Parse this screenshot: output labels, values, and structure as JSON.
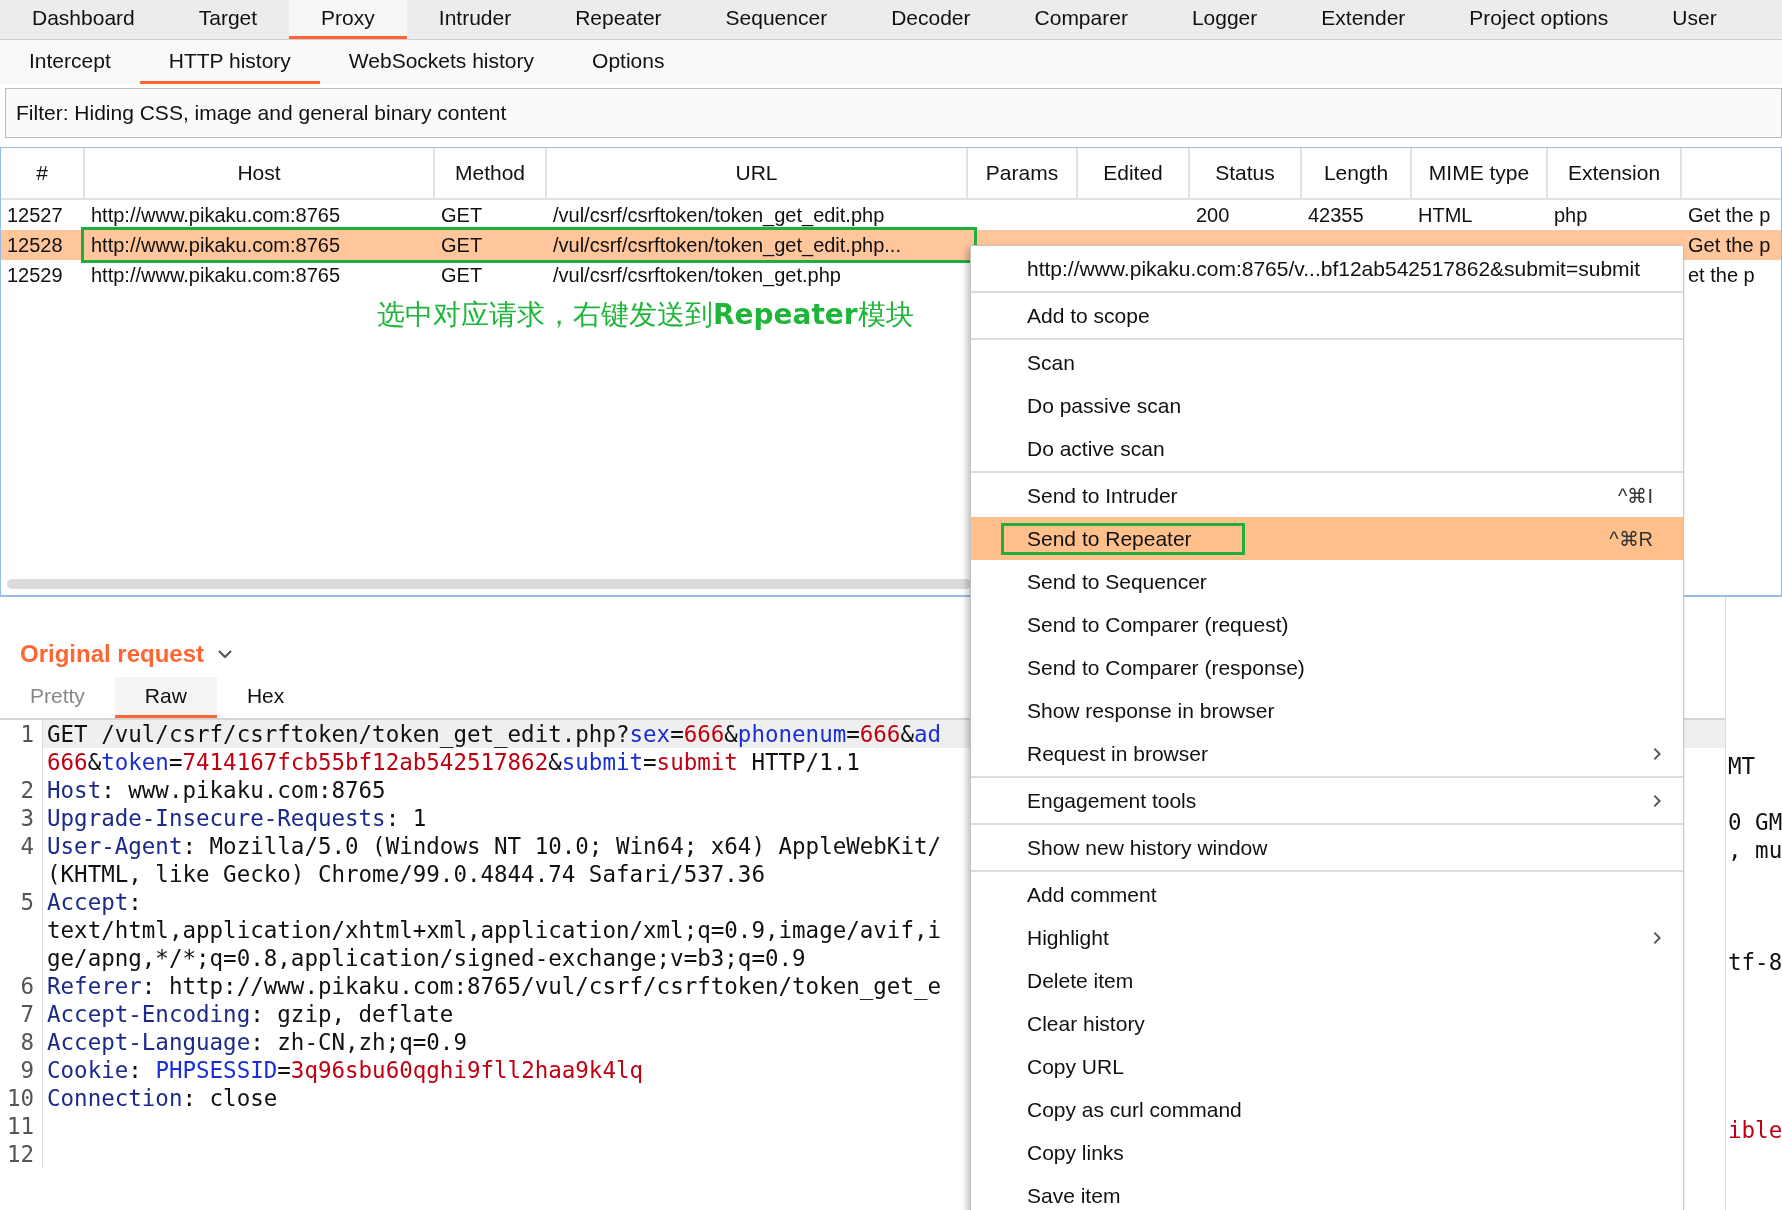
{
  "main_tabs": [
    {
      "label": "Dashboard",
      "selected": false
    },
    {
      "label": "Target",
      "selected": false
    },
    {
      "label": "Proxy",
      "selected": true
    },
    {
      "label": "Intruder",
      "selected": false
    },
    {
      "label": "Repeater",
      "selected": false
    },
    {
      "label": "Sequencer",
      "selected": false
    },
    {
      "label": "Decoder",
      "selected": false
    },
    {
      "label": "Comparer",
      "selected": false
    },
    {
      "label": "Logger",
      "selected": false
    },
    {
      "label": "Extender",
      "selected": false
    },
    {
      "label": "Project options",
      "selected": false
    },
    {
      "label": "User",
      "selected": false
    }
  ],
  "sub_tabs": [
    {
      "label": "Intercept",
      "selected": false
    },
    {
      "label": "HTTP history",
      "selected": true
    },
    {
      "label": "WebSockets history",
      "selected": false
    },
    {
      "label": "Options",
      "selected": false
    }
  ],
  "filter": {
    "text": "Filter: Hiding CSS, image and general binary content"
  },
  "table": {
    "columns": [
      "#",
      "Host",
      "Method",
      "URL",
      "Params",
      "Edited",
      "Status",
      "Length",
      "MIME type",
      "Extension"
    ],
    "rows": [
      {
        "selected": false,
        "annotated": false,
        "cells": [
          "12527",
          "http://www.pikaku.com:8765",
          "GET",
          "/vul/csrf/csrftoken/token_get_edit.php",
          null,
          null,
          "200",
          "42355",
          "HTML",
          "php",
          "Get the p"
        ]
      },
      {
        "selected": true,
        "annotated": true,
        "cells": [
          "12528",
          "http://www.pikaku.com:8765",
          "GET",
          "/vul/csrf/csrftoken/token_get_edit.php...",
          null,
          null,
          null,
          null,
          null,
          null,
          "Get the p"
        ]
      },
      {
        "selected": false,
        "annotated": false,
        "cells": [
          "12529",
          "http://www.pikaku.com:8765",
          "GET",
          "/vul/csrf/csrftoken/token_get.php",
          null,
          null,
          null,
          null,
          null,
          null,
          "et the p"
        ]
      }
    ]
  },
  "annotation": "选中对应请求，右键发送到**Repeater**模块",
  "request_panel": {
    "title": "Original request",
    "tabs": [
      {
        "label": "Pretty",
        "selected": false
      },
      {
        "label": "Raw",
        "selected": true
      },
      {
        "label": "Hex",
        "selected": false
      }
    ],
    "rows": [
      {
        "number": "1",
        "highlighted": true,
        "segments": [
          {
            "kind": "plain",
            "text": "GET /vul/csrf/csrftoken/token_get_edit.php?"
          },
          {
            "kind": "param",
            "text": "sex"
          },
          {
            "kind": "plain",
            "text": "="
          },
          {
            "kind": "value",
            "text": "666"
          },
          {
            "kind": "plain",
            "text": "&"
          },
          {
            "kind": "param",
            "text": "phonenum"
          },
          {
            "kind": "plain",
            "text": "="
          },
          {
            "kind": "value",
            "text": "666"
          },
          {
            "kind": "plain",
            "text": "&"
          },
          {
            "kind": "param",
            "text": "ad"
          }
        ]
      },
      {
        "highlighted": false,
        "segments": [
          {
            "kind": "value",
            "text": "666"
          },
          {
            "kind": "plain",
            "text": "&"
          },
          {
            "kind": "param",
            "text": "token"
          },
          {
            "kind": "plain",
            "text": "="
          },
          {
            "kind": "value",
            "text": "7414167fcb55bf12ab542517862"
          },
          {
            "kind": "plain",
            "text": "&"
          },
          {
            "kind": "param",
            "text": "submit"
          },
          {
            "kind": "plain",
            "text": "="
          },
          {
            "kind": "value",
            "text": "submit"
          },
          {
            "kind": "plain",
            "text": " HTTP/1.1"
          }
        ]
      },
      {
        "number": "2",
        "highlighted": false,
        "segments": [
          {
            "kind": "header",
            "text": "Host"
          },
          {
            "kind": "plain",
            "text": ": www.pikaku.com:8765"
          }
        ]
      },
      {
        "number": "3",
        "highlighted": false,
        "segments": [
          {
            "kind": "header",
            "text": "Upgrade-Insecure-Requests"
          },
          {
            "kind": "plain",
            "text": ": 1"
          }
        ]
      },
      {
        "number": "4",
        "highlighted": false,
        "segments": [
          {
            "kind": "header",
            "text": "User-Agent"
          },
          {
            "kind": "plain",
            "text": ": Mozilla/5.0 (Windows NT 10.0; Win64; x64) AppleWebKit/"
          }
        ]
      },
      {
        "highlighted": false,
        "segments": [
          {
            "kind": "plain",
            "text": "(KHTML, like Gecko) Chrome/99.0.4844.74 Safari/537.36"
          }
        ]
      },
      {
        "number": "5",
        "highlighted": false,
        "segments": [
          {
            "kind": "header",
            "text": "Accept"
          },
          {
            "kind": "plain",
            "text": ":"
          }
        ]
      },
      {
        "highlighted": false,
        "segments": [
          {
            "kind": "plain",
            "text": "text/html,application/xhtml+xml,application/xml;q=0.9,image/avif,i"
          }
        ]
      },
      {
        "highlighted": false,
        "segments": [
          {
            "kind": "plain",
            "text": "ge/apng,*/*;q=0.8,application/signed-exchange;v=b3;q=0.9"
          }
        ]
      },
      {
        "number": "6",
        "highlighted": false,
        "segments": [
          {
            "kind": "header",
            "text": "Referer"
          },
          {
            "kind": "plain",
            "text": ": http://www.pikaku.com:8765/vul/csrf/csrftoken/token_get_e"
          }
        ]
      },
      {
        "number": "7",
        "highlighted": false,
        "segments": [
          {
            "kind": "header",
            "text": "Accept-Encoding"
          },
          {
            "kind": "plain",
            "text": ": gzip, deflate"
          }
        ]
      },
      {
        "number": "8",
        "highlighted": false,
        "segments": [
          {
            "kind": "header",
            "text": "Accept-Language"
          },
          {
            "kind": "plain",
            "text": ": zh-CN,zh;q=0.9"
          }
        ]
      },
      {
        "number": "9",
        "highlighted": false,
        "segments": [
          {
            "kind": "header",
            "text": "Cookie"
          },
          {
            "kind": "plain",
            "text": ": "
          },
          {
            "kind": "param",
            "text": "PHPSESSID"
          },
          {
            "kind": "plain",
            "text": "="
          },
          {
            "kind": "value",
            "text": "3q96sbu60qghi9fll2haa9k4lq"
          }
        ]
      },
      {
        "number": "10",
        "highlighted": false,
        "segments": [
          {
            "kind": "header",
            "text": "Connection"
          },
          {
            "kind": "plain",
            "text": ": close"
          }
        ]
      },
      {
        "number": "11",
        "highlighted": false
      },
      {
        "number": "12",
        "highlighted": false
      }
    ]
  },
  "response_panel": {
    "lines": [
      {
        "kind": "blank"
      },
      {
        "kind": "plain",
        "text": "MT"
      },
      {
        "kind": "blank"
      },
      {
        "kind": "plain",
        "text": "0 GM"
      },
      {
        "kind": "plain",
        "text": ", mu"
      },
      {
        "kind": "blank"
      },
      {
        "kind": "blank"
      },
      {
        "kind": "blank"
      },
      {
        "kind": "plain",
        "text": "tf-8"
      },
      {
        "kind": "blank"
      },
      {
        "kind": "blank"
      },
      {
        "kind": "blank"
      },
      {
        "kind": "blank"
      },
      {
        "kind": "blank"
      },
      {
        "kind": "value",
        "text": "ible"
      }
    ]
  },
  "menu": {
    "groups": [
      {
        "items": [
          {
            "label": "http://www.pikaku.com:8765/v...bf12ab542517862&submit=submit",
            "selected": false,
            "submenu": false,
            "annotated": false
          }
        ]
      },
      {
        "items": [
          {
            "label": "Add to scope",
            "selected": false,
            "submenu": false,
            "annotated": false
          }
        ]
      },
      {
        "items": [
          {
            "label": "Scan",
            "selected": false,
            "submenu": false,
            "annotated": false
          },
          {
            "label": "Do passive scan",
            "selected": false,
            "submenu": false,
            "annotated": false
          },
          {
            "label": "Do active scan",
            "selected": false,
            "submenu": false,
            "annotated": false
          }
        ]
      },
      {
        "items": [
          {
            "label": "Send to Intruder",
            "shortcut": "^⌘I",
            "selected": false,
            "submenu": false,
            "annotated": false
          },
          {
            "label": "Send to Repeater",
            "shortcut": "^⌘R",
            "selected": true,
            "submenu": false,
            "annotated": true
          },
          {
            "label": "Send to Sequencer",
            "selected": false,
            "submenu": false,
            "annotated": false
          },
          {
            "label": "Send to Comparer (request)",
            "selected": false,
            "submenu": false,
            "annotated": false
          },
          {
            "label": "Send to Comparer (response)",
            "selected": false,
            "submenu": false,
            "annotated": false
          },
          {
            "label": "Show response in browser",
            "selected": false,
            "submenu": false,
            "annotated": false
          },
          {
            "label": "Request in browser",
            "selected": false,
            "submenu": true,
            "annotated": false
          }
        ]
      },
      {
        "items": [
          {
            "label": "Engagement tools",
            "selected": false,
            "submenu": true,
            "annotated": false
          }
        ]
      },
      {
        "items": [
          {
            "label": "Show new history window",
            "selected": false,
            "submenu": false,
            "annotated": false
          }
        ]
      },
      {
        "items": [
          {
            "label": "Add comment",
            "selected": false,
            "submenu": false,
            "annotated": false
          },
          {
            "label": "Highlight",
            "selected": false,
            "submenu": true,
            "annotated": false
          },
          {
            "label": "Delete item",
            "selected": false,
            "submenu": false,
            "annotated": false
          },
          {
            "label": "Clear history",
            "selected": false,
            "submenu": false,
            "annotated": false
          },
          {
            "label": "Copy URL",
            "selected": false,
            "submenu": false,
            "annotated": false
          },
          {
            "label": "Copy as curl command",
            "selected": false,
            "submenu": false,
            "annotated": false
          },
          {
            "label": "Copy links",
            "selected": false,
            "submenu": false,
            "annotated": false
          },
          {
            "label": "Save item",
            "selected": false,
            "submenu": false,
            "annotated": false
          }
        ]
      }
    ]
  }
}
